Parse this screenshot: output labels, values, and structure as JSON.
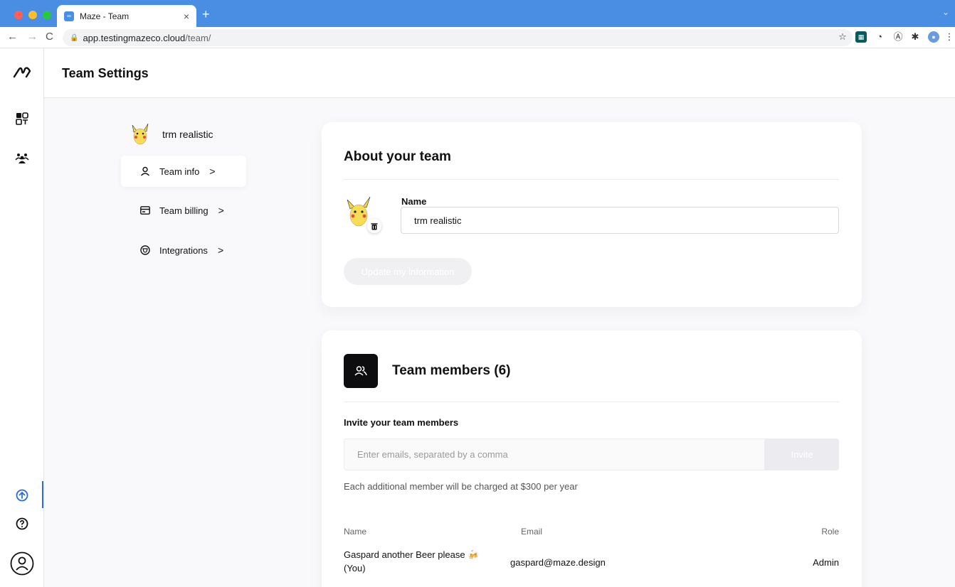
{
  "browser": {
    "tab_title": "Maze - Team",
    "tab_close": "×",
    "new_tab": "+",
    "url_host": "app.testingmazeco.cloud",
    "url_path": "/team/"
  },
  "header": {
    "title": "Team Settings"
  },
  "team": {
    "name": "trm realistic"
  },
  "nav": {
    "items": [
      {
        "label": "Team info",
        "icon": "user-icon",
        "active": true
      },
      {
        "label": "Team billing",
        "icon": "card-icon",
        "active": false
      },
      {
        "label": "Integrations",
        "icon": "plug-icon",
        "active": false
      }
    ],
    "chevron": ">"
  },
  "about": {
    "title": "About your team",
    "name_label": "Name",
    "name_value": "trm realistic",
    "update_button": "Update my information"
  },
  "members": {
    "title": "Team members (6)",
    "invite_label": "Invite your team members",
    "invite_placeholder": "Enter emails, separated by a comma",
    "invite_button": "Invite",
    "note": "Each additional member will be charged at $300 per year",
    "columns": {
      "name": "Name",
      "email": "Email",
      "role": "Role"
    },
    "rows": [
      {
        "name_line1": "Gaspard another Beer please 🍻",
        "name_line2": "(You)",
        "email": "gaspard@maze.design",
        "role": "Admin"
      }
    ]
  },
  "colors": {
    "accent": "#2b6be0",
    "chrome": "#4a8ee3",
    "dark": "#0d0d10"
  }
}
